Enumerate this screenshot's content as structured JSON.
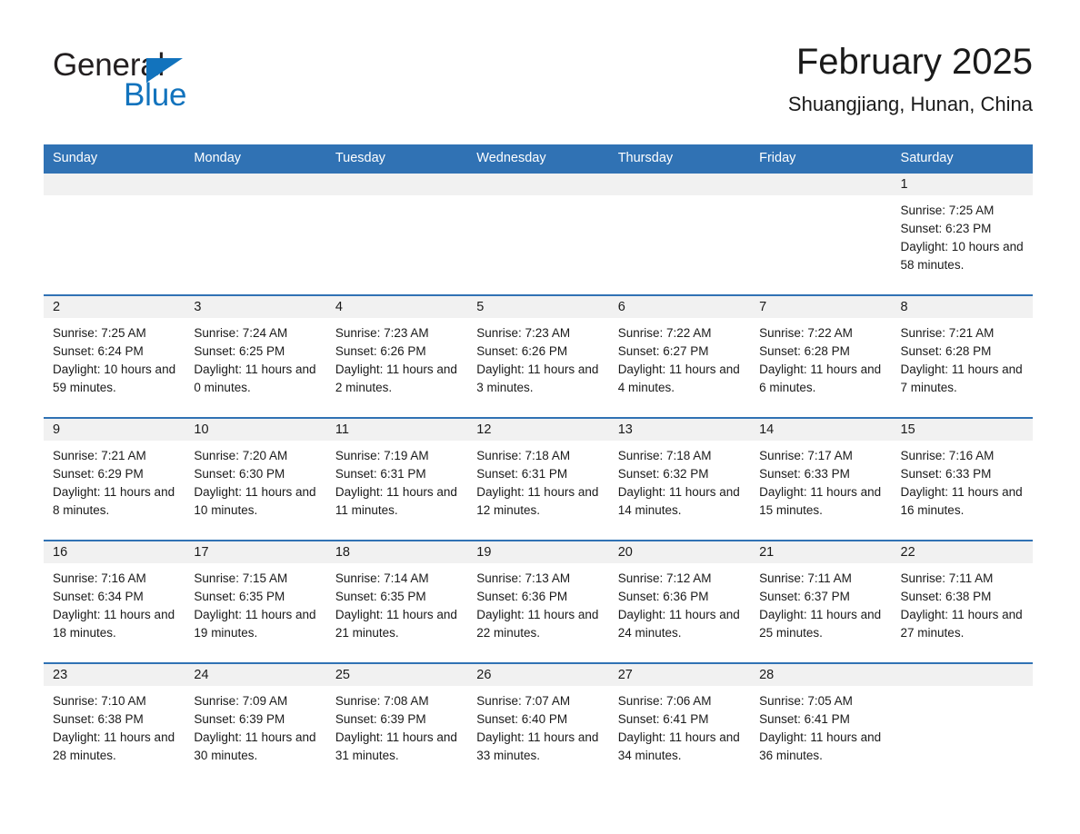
{
  "brand": {
    "name_part1": "General",
    "name_part2": "Blue",
    "triangle_color": "#1273bd",
    "text_color": "#231f20"
  },
  "header": {
    "title": "February 2025",
    "subtitle": "Shuangjiang, Hunan, China"
  },
  "theme": {
    "header_blue": "#3072b4",
    "day_band_gray": "#f1f1f1",
    "text": "#1a1a1a"
  },
  "weekday_headers": [
    "Sunday",
    "Monday",
    "Tuesday",
    "Wednesday",
    "Thursday",
    "Friday",
    "Saturday"
  ],
  "labels": {
    "sunrise_prefix": "Sunrise: ",
    "sunset_prefix": "Sunset: ",
    "daylight_prefix": "Daylight: "
  },
  "weeks": [
    [
      {
        "day": "",
        "empty": true
      },
      {
        "day": "",
        "empty": true
      },
      {
        "day": "",
        "empty": true
      },
      {
        "day": "",
        "empty": true
      },
      {
        "day": "",
        "empty": true
      },
      {
        "day": "",
        "empty": true
      },
      {
        "day": "1",
        "sunrise": "Sunrise: 7:25 AM",
        "sunset": "Sunset: 6:23 PM",
        "daylight": "Daylight: 10 hours and 58 minutes."
      }
    ],
    [
      {
        "day": "2",
        "sunrise": "Sunrise: 7:25 AM",
        "sunset": "Sunset: 6:24 PM",
        "daylight": "Daylight: 10 hours and 59 minutes."
      },
      {
        "day": "3",
        "sunrise": "Sunrise: 7:24 AM",
        "sunset": "Sunset: 6:25 PM",
        "daylight": "Daylight: 11 hours and 0 minutes."
      },
      {
        "day": "4",
        "sunrise": "Sunrise: 7:23 AM",
        "sunset": "Sunset: 6:26 PM",
        "daylight": "Daylight: 11 hours and 2 minutes."
      },
      {
        "day": "5",
        "sunrise": "Sunrise: 7:23 AM",
        "sunset": "Sunset: 6:26 PM",
        "daylight": "Daylight: 11 hours and 3 minutes."
      },
      {
        "day": "6",
        "sunrise": "Sunrise: 7:22 AM",
        "sunset": "Sunset: 6:27 PM",
        "daylight": "Daylight: 11 hours and 4 minutes."
      },
      {
        "day": "7",
        "sunrise": "Sunrise: 7:22 AM",
        "sunset": "Sunset: 6:28 PM",
        "daylight": "Daylight: 11 hours and 6 minutes."
      },
      {
        "day": "8",
        "sunrise": "Sunrise: 7:21 AM",
        "sunset": "Sunset: 6:28 PM",
        "daylight": "Daylight: 11 hours and 7 minutes."
      }
    ],
    [
      {
        "day": "9",
        "sunrise": "Sunrise: 7:21 AM",
        "sunset": "Sunset: 6:29 PM",
        "daylight": "Daylight: 11 hours and 8 minutes."
      },
      {
        "day": "10",
        "sunrise": "Sunrise: 7:20 AM",
        "sunset": "Sunset: 6:30 PM",
        "daylight": "Daylight: 11 hours and 10 minutes."
      },
      {
        "day": "11",
        "sunrise": "Sunrise: 7:19 AM",
        "sunset": "Sunset: 6:31 PM",
        "daylight": "Daylight: 11 hours and 11 minutes."
      },
      {
        "day": "12",
        "sunrise": "Sunrise: 7:18 AM",
        "sunset": "Sunset: 6:31 PM",
        "daylight": "Daylight: 11 hours and 12 minutes."
      },
      {
        "day": "13",
        "sunrise": "Sunrise: 7:18 AM",
        "sunset": "Sunset: 6:32 PM",
        "daylight": "Daylight: 11 hours and 14 minutes."
      },
      {
        "day": "14",
        "sunrise": "Sunrise: 7:17 AM",
        "sunset": "Sunset: 6:33 PM",
        "daylight": "Daylight: 11 hours and 15 minutes."
      },
      {
        "day": "15",
        "sunrise": "Sunrise: 7:16 AM",
        "sunset": "Sunset: 6:33 PM",
        "daylight": "Daylight: 11 hours and 16 minutes."
      }
    ],
    [
      {
        "day": "16",
        "sunrise": "Sunrise: 7:16 AM",
        "sunset": "Sunset: 6:34 PM",
        "daylight": "Daylight: 11 hours and 18 minutes."
      },
      {
        "day": "17",
        "sunrise": "Sunrise: 7:15 AM",
        "sunset": "Sunset: 6:35 PM",
        "daylight": "Daylight: 11 hours and 19 minutes."
      },
      {
        "day": "18",
        "sunrise": "Sunrise: 7:14 AM",
        "sunset": "Sunset: 6:35 PM",
        "daylight": "Daylight: 11 hours and 21 minutes."
      },
      {
        "day": "19",
        "sunrise": "Sunrise: 7:13 AM",
        "sunset": "Sunset: 6:36 PM",
        "daylight": "Daylight: 11 hours and 22 minutes."
      },
      {
        "day": "20",
        "sunrise": "Sunrise: 7:12 AM",
        "sunset": "Sunset: 6:36 PM",
        "daylight": "Daylight: 11 hours and 24 minutes."
      },
      {
        "day": "21",
        "sunrise": "Sunrise: 7:11 AM",
        "sunset": "Sunset: 6:37 PM",
        "daylight": "Daylight: 11 hours and 25 minutes."
      },
      {
        "day": "22",
        "sunrise": "Sunrise: 7:11 AM",
        "sunset": "Sunset: 6:38 PM",
        "daylight": "Daylight: 11 hours and 27 minutes."
      }
    ],
    [
      {
        "day": "23",
        "sunrise": "Sunrise: 7:10 AM",
        "sunset": "Sunset: 6:38 PM",
        "daylight": "Daylight: 11 hours and 28 minutes."
      },
      {
        "day": "24",
        "sunrise": "Sunrise: 7:09 AM",
        "sunset": "Sunset: 6:39 PM",
        "daylight": "Daylight: 11 hours and 30 minutes."
      },
      {
        "day": "25",
        "sunrise": "Sunrise: 7:08 AM",
        "sunset": "Sunset: 6:39 PM",
        "daylight": "Daylight: 11 hours and 31 minutes."
      },
      {
        "day": "26",
        "sunrise": "Sunrise: 7:07 AM",
        "sunset": "Sunset: 6:40 PM",
        "daylight": "Daylight: 11 hours and 33 minutes."
      },
      {
        "day": "27",
        "sunrise": "Sunrise: 7:06 AM",
        "sunset": "Sunset: 6:41 PM",
        "daylight": "Daylight: 11 hours and 34 minutes."
      },
      {
        "day": "28",
        "sunrise": "Sunrise: 7:05 AM",
        "sunset": "Sunset: 6:41 PM",
        "daylight": "Daylight: 11 hours and 36 minutes."
      },
      {
        "day": "",
        "empty": true
      }
    ]
  ]
}
